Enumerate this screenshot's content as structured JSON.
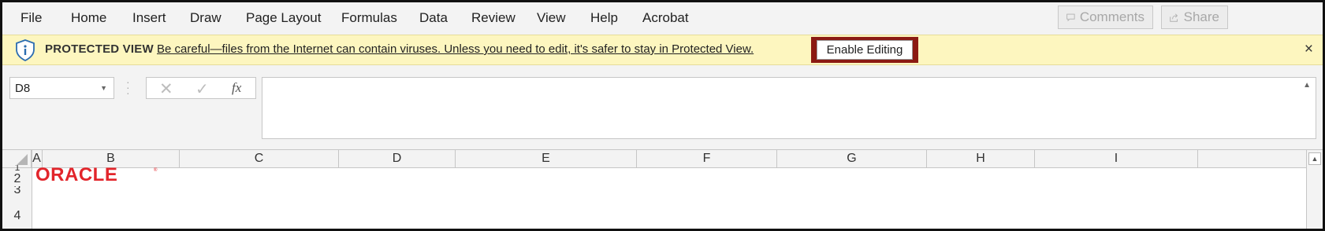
{
  "ribbon": {
    "tabs": [
      "File",
      "Home",
      "Insert",
      "Draw",
      "Page Layout",
      "Formulas",
      "Data",
      "Review",
      "View",
      "Help",
      "Acrobat"
    ],
    "comments_label": "Comments",
    "share_label": "Share"
  },
  "protected_view": {
    "title": "PROTECTED VIEW",
    "message": "Be careful—files from the Internet can contain viruses. Unless you need to edit, it's safer to stay in Protected View.",
    "enable_label": "Enable Editing",
    "close_glyph": "×",
    "highlight_color": "#8b1a12"
  },
  "formula_bar": {
    "name_box": "D8",
    "cancel_glyph": "✕",
    "enter_glyph": "✓",
    "fx_label": "fx",
    "content": ""
  },
  "grid": {
    "columns": [
      "A",
      "B",
      "C",
      "D",
      "E",
      "F",
      "G",
      "H",
      "I"
    ],
    "rows": [
      "1",
      "2",
      "3",
      "4"
    ],
    "logo_text": "ORACLE",
    "logo_color": "#e2252b"
  }
}
